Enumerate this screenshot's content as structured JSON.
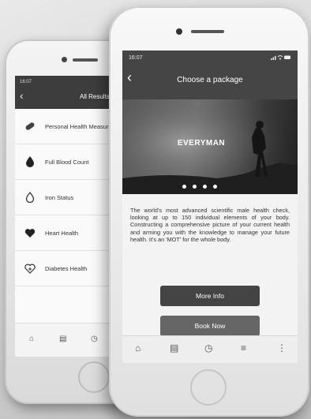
{
  "back_screen": {
    "time": "16:07",
    "title": "All Results",
    "items": [
      {
        "label": "Personal Health Measurements",
        "icon": "pill-icon"
      },
      {
        "label": "Full Blood Count",
        "icon": "blood-drop-icon"
      },
      {
        "label": "Iron Status",
        "icon": "drop-outline-icon"
      },
      {
        "label": "Heart Health",
        "icon": "heart-icon"
      },
      {
        "label": "Diabetes Health",
        "icon": "sugar-heart-icon"
      }
    ]
  },
  "front_screen": {
    "time": "16:07",
    "status_icons": "signal-wifi-battery",
    "title": "Choose a package",
    "hero": {
      "title": "EVERYMAN",
      "dots": 4
    },
    "description": "The world's most advanced scientific male health check, looking at up to 150 individual elements of your body. Constructing a comprehensive picture of your current health and arming you with the knowledge to manage your future health. It's an 'MOT' for the whole body.",
    "buttons": {
      "more_info": "More Info",
      "book_now": "Book Now"
    }
  },
  "colors": {
    "header": "#454545",
    "button_dark": "#444444",
    "button_light": "#666666"
  }
}
